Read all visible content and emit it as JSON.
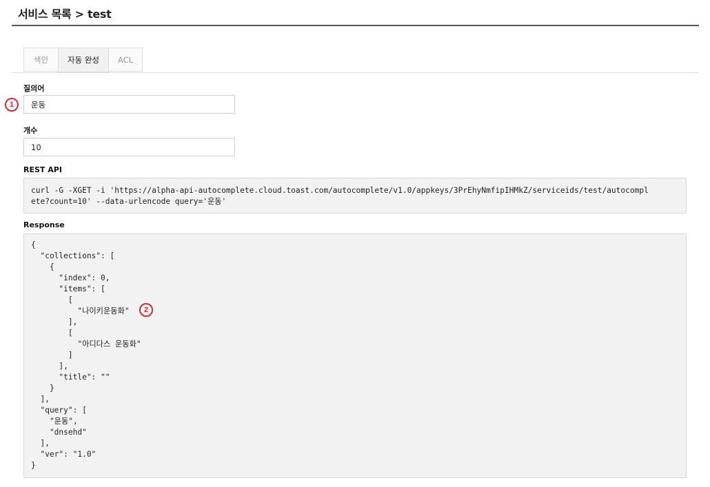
{
  "header": {
    "title": "서비스 목록 > test"
  },
  "tabs": [
    {
      "label": "색인",
      "active": false
    },
    {
      "label": "자동 완성",
      "active": true
    },
    {
      "label": "ACL",
      "active": false
    }
  ],
  "form": {
    "query_label": "질의어",
    "query_value": "운동",
    "count_label": "개수",
    "count_value": "10",
    "rest_api_label": "REST API",
    "rest_api_lines": [
      "curl -G -XGET -i 'https://alpha-api-autocomplete.cloud.toast.com/autocomplete/v1.0/appkeys/3PrEhyNmfipIHMkZ/serviceids/test/autocompl",
      "ete?count=10' --data-urlencode query='운동'"
    ],
    "response_label": "Response",
    "response_lines": [
      "{",
      "  \"collections\": [",
      "    {",
      "      \"index\": 0,",
      "      \"items\": [",
      "        [",
      "          \"나이키운동화\"",
      "        ],",
      "        [",
      "          \"아디다스 운동화\"",
      "        ]",
      "      ],",
      "      \"title\": \"\"",
      "    }",
      "  ],",
      "  \"query\": [",
      "    \"운동\",",
      "    \"dnsehd\"",
      "  ],",
      "  \"ver\": \"1.0\"",
      "}"
    ]
  },
  "markers": {
    "one": "1",
    "two": "2"
  },
  "colors": {
    "marker_red": "#d9252b",
    "code_bg": "#f2f2f2",
    "title_rule": "#555555"
  }
}
